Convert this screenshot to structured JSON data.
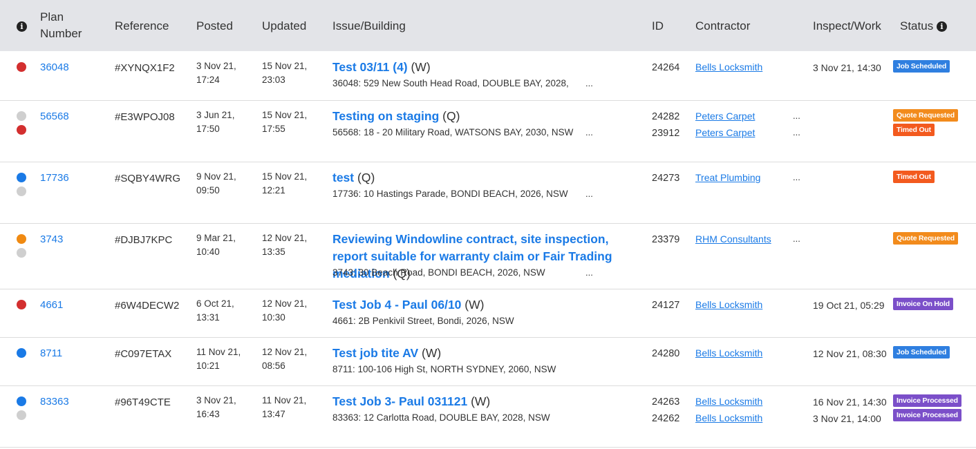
{
  "colors": {
    "link": "#1a7ae6",
    "dot_red": "#d32f2f",
    "dot_grey": "#cfcfcf",
    "dot_blue": "#1a7ae6",
    "dot_orange": "#f08a12",
    "badge_job_scheduled": "#2f7fe0",
    "badge_quote_requested": "#f28b1c",
    "badge_timed_out": "#f35a1e",
    "badge_invoice": "#7b4fc9"
  },
  "header": {
    "plan_number_line1": "Plan",
    "plan_number_line2": "Number",
    "reference": "Reference",
    "posted": "Posted",
    "updated": "Updated",
    "issue_building": "Issue/Building",
    "id": "ID",
    "contractor": "Contractor",
    "inspect_work": "Inspect/Work",
    "status": "Status",
    "info_icon": "i"
  },
  "rows": [
    {
      "plan": "36048",
      "ref": "#XYNQX1F2",
      "posted_date": "3 Nov 21,",
      "posted_time": "17:24",
      "updated_date": "15 Nov 21,",
      "updated_time": "23:03",
      "title": "Test 03/11 (4)",
      "type": "(W)",
      "address": "36048: 529 New South Head Road, DOUBLE BAY, 2028,",
      "ellipsis": "...",
      "ids": [
        "24264"
      ],
      "contractors": [
        "Bells Locksmith"
      ],
      "contractor_ellipsis": [
        ""
      ],
      "inspect": [
        "3 Nov 21, 14:30"
      ],
      "statuses": [
        "Job Scheduled"
      ],
      "dots": [
        "red"
      ]
    },
    {
      "plan": "56568",
      "ref": "#E3WPOJ08",
      "posted_date": "3 Jun 21,",
      "posted_time": "17:50",
      "updated_date": "15 Nov 21,",
      "updated_time": "17:55",
      "title": "Testing on staging",
      "type": "(Q)",
      "address": "56568: 18 - 20 Military Road, WATSONS BAY, 2030, NSW",
      "ellipsis": "...",
      "ids": [
        "24282",
        "23912"
      ],
      "contractors": [
        "Peters Carpet",
        "Peters Carpet"
      ],
      "contractor_ellipsis": [
        "...",
        "..."
      ],
      "inspect": [],
      "statuses": [
        "Quote Requested",
        "Timed Out"
      ],
      "dots": [
        "grey",
        "red"
      ]
    },
    {
      "plan": "17736",
      "ref": "#SQBY4WRG",
      "posted_date": "9 Nov 21,",
      "posted_time": "09:50",
      "updated_date": "15 Nov 21,",
      "updated_time": "12:21",
      "title": "test",
      "type": "(Q)",
      "address": "17736: 10 Hastings Parade, BONDI BEACH, 2026, NSW",
      "ellipsis": "...",
      "ids": [
        "24273"
      ],
      "contractors": [
        "Treat Plumbing"
      ],
      "contractor_ellipsis": [
        "..."
      ],
      "inspect": [],
      "statuses": [
        "Timed Out"
      ],
      "dots": [
        "blue",
        "grey"
      ]
    },
    {
      "plan": "3743",
      "ref": "#DJBJ7KPC",
      "posted_date": "9 Mar 21,",
      "posted_time": "10:40",
      "updated_date": "12 Nov 21,",
      "updated_time": "13:35",
      "title": "Reviewing Windowline contract, site inspection, report suitable for warranty claim or Fair Trading mediation",
      "type": "(Q)",
      "address": "3743: 30 Beach Road, BONDI BEACH, 2026, NSW",
      "ellipsis": "...",
      "ids": [
        "23379"
      ],
      "contractors": [
        "RHM Consultants"
      ],
      "contractor_ellipsis": [
        "..."
      ],
      "inspect": [],
      "statuses": [
        "Quote Requested"
      ],
      "dots": [
        "orange",
        "grey"
      ]
    },
    {
      "plan": "4661",
      "ref": "#6W4DECW2",
      "posted_date": "6 Oct 21,",
      "posted_time": "13:31",
      "updated_date": "12 Nov 21,",
      "updated_time": "10:30",
      "title": "Test Job 4 - Paul 06/10",
      "type": "(W)",
      "address": "4661: 2B Penkivil Street, Bondi, 2026, NSW",
      "ellipsis": "",
      "ids": [
        "24127"
      ],
      "contractors": [
        "Bells Locksmith"
      ],
      "contractor_ellipsis": [
        ""
      ],
      "inspect": [
        "19 Oct 21, 05:29"
      ],
      "statuses": [
        "Invoice On Hold"
      ],
      "dots": [
        "red"
      ]
    },
    {
      "plan": "8711",
      "ref": "#C097ETAX",
      "posted_date": "11 Nov 21,",
      "posted_time": "10:21",
      "updated_date": "12 Nov 21,",
      "updated_time": "08:56",
      "title": "Test job tite AV",
      "type": "(W)",
      "address": "8711: 100-106 High St, NORTH SYDNEY, 2060, NSW",
      "ellipsis": "",
      "ids": [
        "24280"
      ],
      "contractors": [
        "Bells Locksmith"
      ],
      "contractor_ellipsis": [
        ""
      ],
      "inspect": [
        "12 Nov 21, 08:30"
      ],
      "statuses": [
        "Job Scheduled"
      ],
      "dots": [
        "blue"
      ]
    },
    {
      "plan": "83363",
      "ref": "#96T49CTE",
      "posted_date": "3 Nov 21,",
      "posted_time": "16:43",
      "updated_date": "11 Nov 21,",
      "updated_time": "13:47",
      "title": "Test Job 3- Paul 031121",
      "type": "(W)",
      "address": "83363: 12 Carlotta Road, DOUBLE BAY, 2028, NSW",
      "ellipsis": "",
      "ids": [
        "24263",
        "24262"
      ],
      "contractors": [
        "Bells Locksmith",
        "Bells Locksmith"
      ],
      "contractor_ellipsis": [
        "",
        ""
      ],
      "inspect": [
        "16 Nov 21, 14:30",
        "3 Nov 21, 14:00"
      ],
      "statuses": [
        "Invoice Processed",
        "Invoice Processed"
      ],
      "dots": [
        "blue",
        "grey"
      ]
    }
  ]
}
